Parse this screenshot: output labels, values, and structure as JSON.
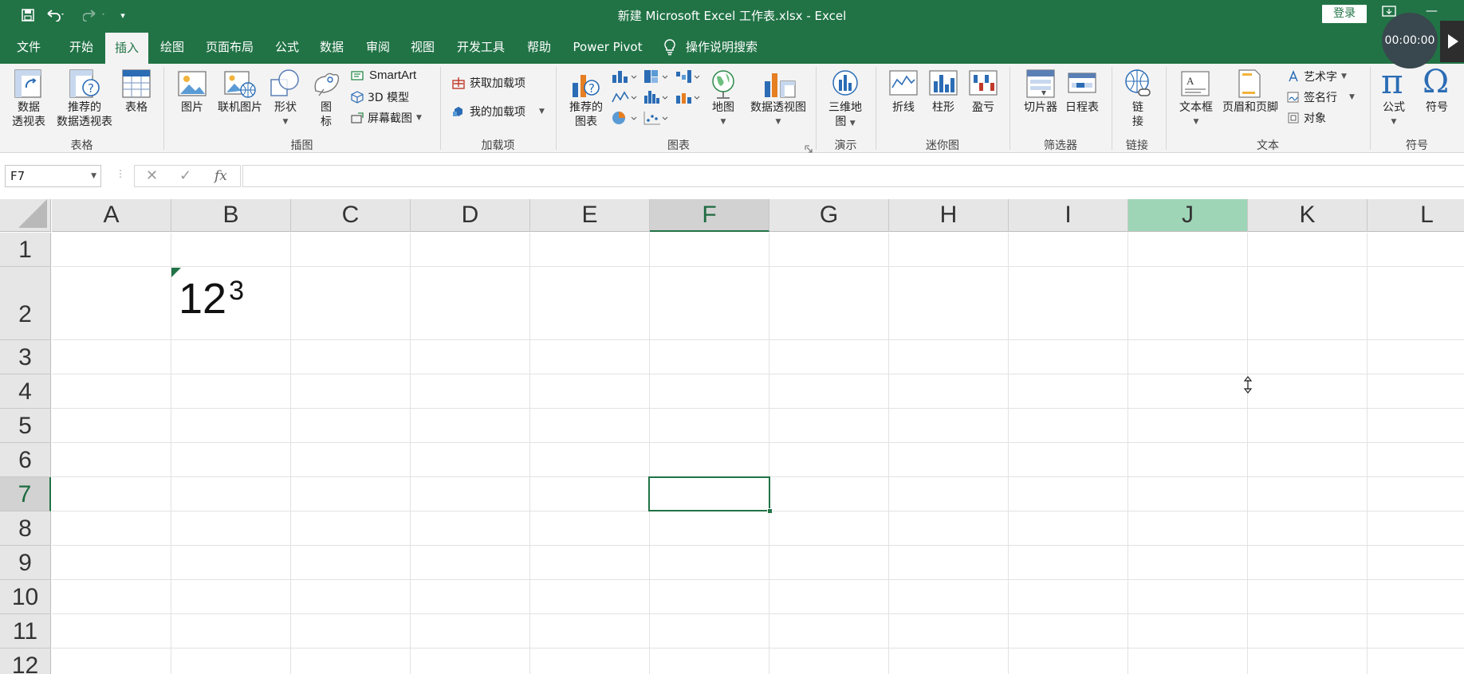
{
  "window": {
    "title": "新建 Microsoft Excel 工作表.xlsx  -  Excel",
    "login_label": "登录",
    "timer": "00:00:00",
    "qat_icons": [
      "save-icon",
      "undo-icon",
      "redo-icon",
      "customize-qat-icon"
    ]
  },
  "tabs": [
    {
      "label": "文件",
      "active": false
    },
    {
      "label": "开始",
      "active": false
    },
    {
      "label": "插入",
      "active": true
    },
    {
      "label": "绘图",
      "active": false
    },
    {
      "label": "页面布局",
      "active": false
    },
    {
      "label": "公式",
      "active": false
    },
    {
      "label": "数据",
      "active": false
    },
    {
      "label": "审阅",
      "active": false
    },
    {
      "label": "视图",
      "active": false
    },
    {
      "label": "开发工具",
      "active": false
    },
    {
      "label": "帮助",
      "active": false
    },
    {
      "label": "Power Pivot",
      "active": false
    },
    {
      "label": "操作说明搜索",
      "active": false
    }
  ],
  "ribbon": {
    "groups": {
      "tables": "表格",
      "illustrations": "插图",
      "addins": "加载项",
      "charts": "图表",
      "tours": "演示",
      "sparklines": "迷你图",
      "filters": "筛选器",
      "links": "链接",
      "text": "文本",
      "symbols": "符号"
    },
    "pivot_line1": "数据",
    "pivot_line2": "透视表",
    "recommended_pivot_line1": "推荐的",
    "recommended_pivot_line2": "数据透视表",
    "table": "表格",
    "picture": "图片",
    "online_picture": "联机图片",
    "shapes": "形状",
    "icons_line1": "图",
    "icons_line2": "标",
    "smartart": "SmartArt",
    "model3d": "3D 模型",
    "screenshot": "屏幕截图",
    "get_addins": "获取加载项",
    "my_addins": "我的加载项",
    "recommended_charts_line1": "推荐的",
    "recommended_charts_line2": "图表",
    "map": "地图",
    "pivot_chart": "数据透视图",
    "map3d_line1": "三维地",
    "map3d_line2": "图",
    "spark_line": "折线",
    "spark_column": "柱形",
    "spark_winloss": "盈亏",
    "slicer": "切片器",
    "timeline": "日程表",
    "link_line1": "链",
    "link_line2": "接",
    "textbox": "文本框",
    "header_footer": "页眉和页脚",
    "wordart": "艺术字",
    "signature": "签名行",
    "object": "对象",
    "equation": "公式",
    "symbol": "符号"
  },
  "formula_bar": {
    "name_box": "F7",
    "fx_label": "fx",
    "formula": ""
  },
  "grid": {
    "columns": [
      "A",
      "B",
      "C",
      "D",
      "E",
      "F",
      "G",
      "H",
      "I",
      "J",
      "K",
      "L"
    ],
    "rows": [
      "1",
      "2",
      "3",
      "4",
      "5",
      "6",
      "7",
      "8",
      "9",
      "10",
      "11",
      "12"
    ],
    "selected_column": "F",
    "selected_row": "7",
    "highlighted_column": "J",
    "cell_b2_base": "12",
    "cell_b2_superscript": "3"
  },
  "colors": {
    "accent": "#217346",
    "column_highlight": "#9fd5b7"
  }
}
